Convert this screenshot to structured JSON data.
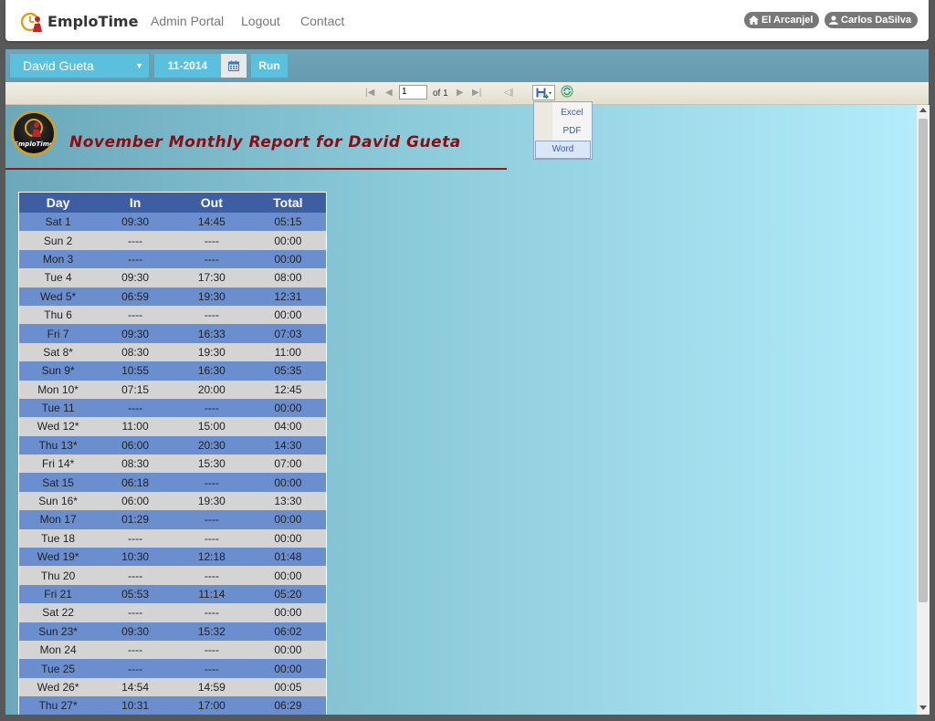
{
  "app": {
    "brand": "EmploTime"
  },
  "nav": {
    "admin_portal": "Admin Portal",
    "logout": "Logout",
    "contact": "Contact"
  },
  "user": {
    "location": "El Arcanjel",
    "name": "Carlos DaSilva"
  },
  "controls": {
    "employee": "David Gueta",
    "month": "11-2014",
    "run_label": "Run"
  },
  "viewer": {
    "page_value": "1",
    "page_of": "of 1"
  },
  "export_menu": [
    "Excel",
    "PDF",
    "Word"
  ],
  "report": {
    "logo_text": "EmploTime",
    "title": "November Monthly Report for David Gueta",
    "columns": [
      "Day",
      "In",
      "Out",
      "Total"
    ],
    "rows": [
      [
        "Sat 1",
        "09:30",
        "14:45",
        "05:15"
      ],
      [
        "Sun 2",
        "----",
        "----",
        "00:00"
      ],
      [
        "Mon 3",
        "----",
        "----",
        "00:00"
      ],
      [
        "Tue 4",
        "09:30",
        "17:30",
        "08:00"
      ],
      [
        "Wed 5*",
        "06:59",
        "19:30",
        "12:31"
      ],
      [
        "Thu 6",
        "----",
        "----",
        "00:00"
      ],
      [
        "Fri 7",
        "09:30",
        "16:33",
        "07:03"
      ],
      [
        "Sat 8*",
        "08:30",
        "19:30",
        "11:00"
      ],
      [
        "Sun 9*",
        "10:55",
        "16:30",
        "05:35"
      ],
      [
        "Mon 10*",
        "07:15",
        "20:00",
        "12:45"
      ],
      [
        "Tue 11",
        "----",
        "----",
        "00:00"
      ],
      [
        "Wed 12*",
        "11:00",
        "15:00",
        "04:00"
      ],
      [
        "Thu 13*",
        "06:00",
        "20:30",
        "14:30"
      ],
      [
        "Fri 14*",
        "08:30",
        "15:30",
        "07:00"
      ],
      [
        "Sat 15",
        "06:18",
        "----",
        "00:00"
      ],
      [
        "Sun 16*",
        "06:00",
        "19:30",
        "13:30"
      ],
      [
        "Mon 17",
        "01:29",
        "----",
        "00:00"
      ],
      [
        "Tue 18",
        "----",
        "----",
        "00:00"
      ],
      [
        "Wed 19*",
        "10:30",
        "12:18",
        "01:48"
      ],
      [
        "Thu 20",
        "----",
        "----",
        "00:00"
      ],
      [
        "Fri 21",
        "05:53",
        "11:14",
        "05:20"
      ],
      [
        "Sat 22",
        "----",
        "----",
        "00:00"
      ],
      [
        "Sun 23*",
        "09:30",
        "15:32",
        "06:02"
      ],
      [
        "Mon 24",
        "----",
        "----",
        "00:00"
      ],
      [
        "Tue 25",
        "----",
        "----",
        "00:00"
      ],
      [
        "Wed 26*",
        "14:54",
        "14:59",
        "00:05"
      ],
      [
        "Thu 27*",
        "10:31",
        "17:00",
        "06:29"
      ]
    ]
  }
}
